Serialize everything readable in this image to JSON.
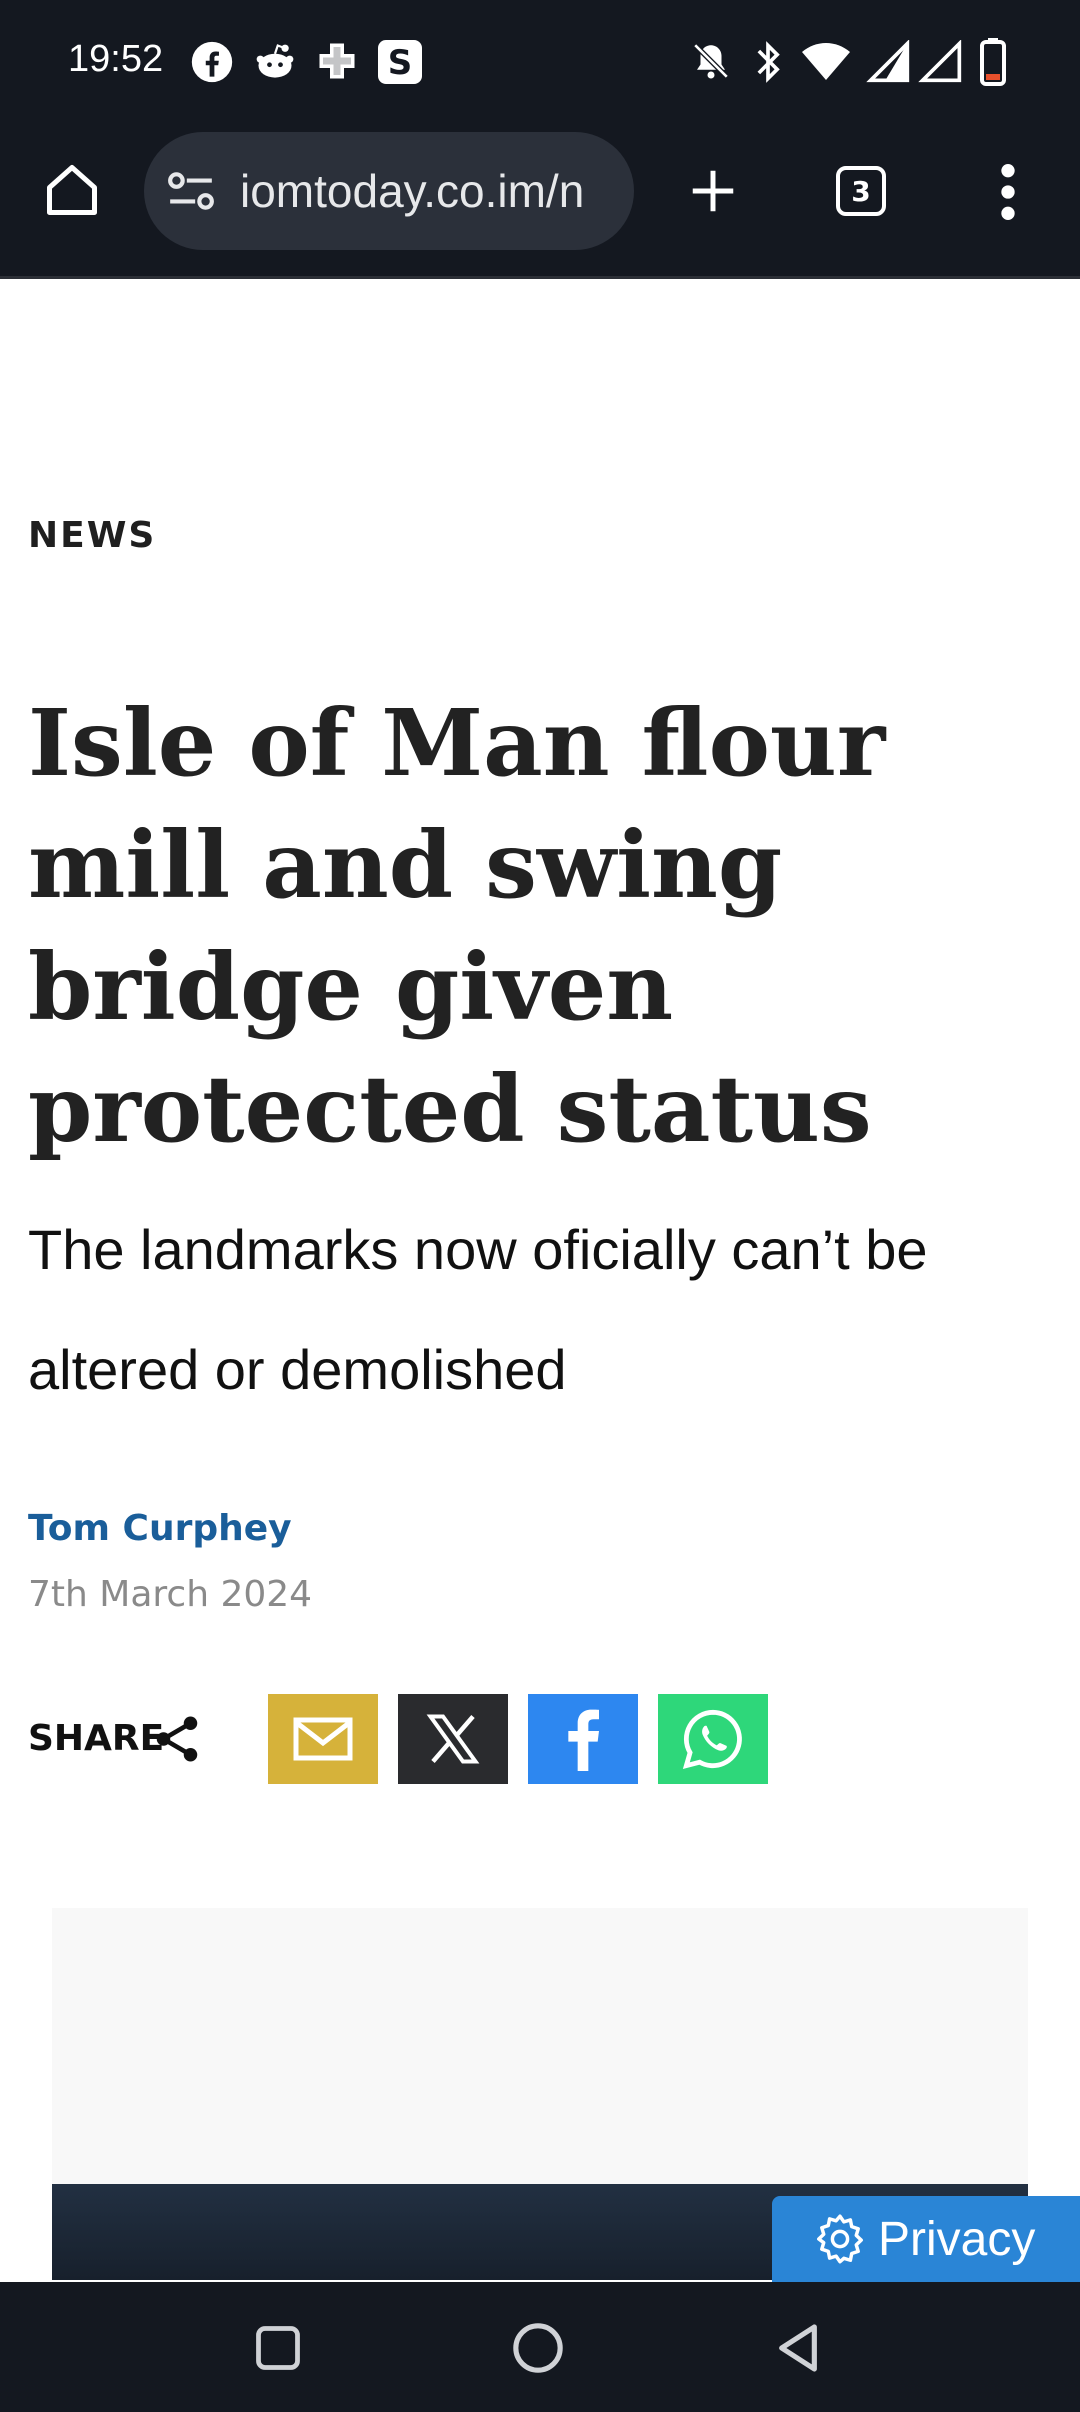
{
  "status_bar": {
    "time": "19:52"
  },
  "browser": {
    "url": "iomtoday.co.im/n",
    "tab_count": "3"
  },
  "article": {
    "section": "NEWS",
    "headline": "Isle of Man flour mill and swing bridge given protected status",
    "subheadline": "The landmarks now oficially can’t be altered or demolished",
    "author": "Tom Curphey",
    "date": "7th March 2024",
    "share_label": "SHARE"
  },
  "share_buttons": [
    {
      "name": "email",
      "color": "#d6b23a"
    },
    {
      "name": "x",
      "color": "#2a2b2e"
    },
    {
      "name": "facebook",
      "color": "#2d87f0"
    },
    {
      "name": "whatsapp",
      "color": "#2ed77a"
    }
  ],
  "privacy_button": {
    "label": "Privacy",
    "color": "#2a85d6"
  }
}
